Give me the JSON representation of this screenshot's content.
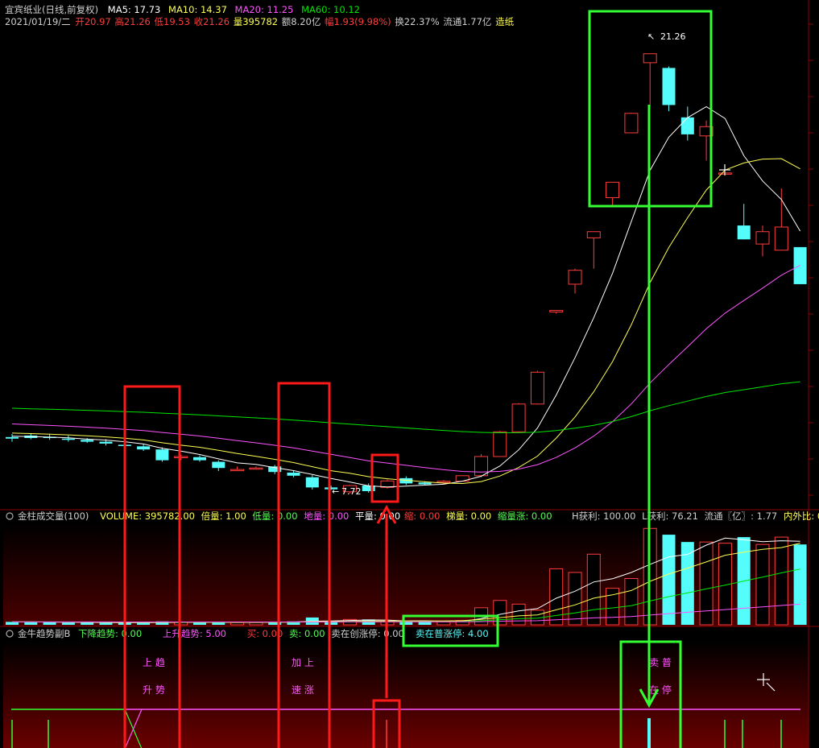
{
  "colors": {
    "up": "#ff3c3c",
    "down": "#54fcfc",
    "ma5": "#ffffff",
    "ma10": "#ffff54",
    "ma20": "#ff54ff",
    "ma60": "#00e600",
    "annot_red": "#ff1a1a",
    "annot_green": "#33ff33",
    "pane_bg": "#000000",
    "grad_top": "#000000",
    "grad_bottom": "#5a0000"
  },
  "header": {
    "stock": "宜宾纸业(日线,前复权)",
    "ma5": "MA5: 17.73",
    "ma10": "MA10: 14.37",
    "ma20": "MA20: 11.25",
    "ma60": "MA60: 10.12",
    "date": "2021/01/19/二",
    "open": "开20.97",
    "high": "高21.26",
    "low": "低19.53",
    "close": "收21.26",
    "volume": "量395782",
    "amount": "额8.20亿",
    "change": "幅1.93(9.98%)",
    "turnover": "换22.37%",
    "float": "流通1.77亿",
    "sector": "造纸"
  },
  "volume_header": {
    "name": "金柱成交量(100)",
    "volume": "VOLUME: 395782.00",
    "bei": "倍量: 1.00",
    "di": "低量: 0.00",
    "dil": "地量: 0.00",
    "ping": "平量: 0.00",
    "suo": "缩: 0.00",
    "ti": "梯量: 0.00",
    "suozhang": "缩量涨: 0.00",
    "hprofit": "H获利: 100.00",
    "lprofit": "L获利: 76.21",
    "liutong": "流通〖亿〗: 1.77",
    "neiwai": "内外比: 0"
  },
  "trend_header": {
    "name": "金牛趋势副B",
    "down": "下降趋势: 0.00",
    "up": "上升趋势: 5.00",
    "buy": "买: 0.00",
    "sell": "卖: 0.00",
    "sell_new": "卖在创涨停: 0.00",
    "sell_pu": "卖在普涨停: 4.00"
  },
  "annotations": {
    "up_trend_1": "上 趋",
    "up_trend_2": "升 势",
    "accel_1": "加 上",
    "accel_2": "速 涨",
    "sell_1": "卖 普",
    "sell_2": "在 停",
    "high_label": "21.26",
    "low_label": "7.72"
  },
  "chart_data": {
    "type": "candlestick",
    "ylim": [
      6.5,
      23.0
    ],
    "bars": [
      {
        "o": 8.85,
        "h": 8.95,
        "l": 8.7,
        "c": 8.8
      },
      {
        "o": 8.9,
        "h": 8.98,
        "l": 8.78,
        "c": 8.82
      },
      {
        "o": 8.86,
        "h": 8.96,
        "l": 8.76,
        "c": 8.82
      },
      {
        "o": 8.8,
        "h": 8.9,
        "l": 8.7,
        "c": 8.78
      },
      {
        "o": 8.76,
        "h": 8.82,
        "l": 8.66,
        "c": 8.7
      },
      {
        "o": 8.7,
        "h": 8.78,
        "l": 8.58,
        "c": 8.64
      },
      {
        "o": 8.6,
        "h": 8.7,
        "l": 8.5,
        "c": 8.56
      },
      {
        "o": 8.55,
        "h": 8.62,
        "l": 8.4,
        "c": 8.45
      },
      {
        "o": 8.45,
        "h": 8.52,
        "l": 8.05,
        "c": 8.1
      },
      {
        "o": 8.2,
        "h": 8.28,
        "l": 8.1,
        "c": 8.22
      },
      {
        "o": 8.2,
        "h": 8.26,
        "l": 8.05,
        "c": 8.1
      },
      {
        "o": 8.05,
        "h": 8.1,
        "l": 7.75,
        "c": 7.85
      },
      {
        "o": 7.8,
        "h": 7.9,
        "l": 7.75,
        "c": 7.8
      },
      {
        "o": 7.85,
        "h": 7.9,
        "l": 7.8,
        "c": 7.85
      },
      {
        "o": 7.9,
        "h": 7.95,
        "l": 7.65,
        "c": 7.72
      },
      {
        "o": 7.7,
        "h": 7.75,
        "l": 7.55,
        "c": 7.6
      },
      {
        "o": 7.55,
        "h": 7.62,
        "l": 7.15,
        "c": 7.22
      },
      {
        "o": 7.22,
        "h": 7.28,
        "l": 7.14,
        "c": 7.16
      },
      {
        "o": 7.08,
        "h": 7.3,
        "l": 7.02,
        "c": 7.28
      },
      {
        "o": 7.28,
        "h": 7.35,
        "l": 7.05,
        "c": 7.1
      },
      {
        "o": 7.22,
        "h": 7.48,
        "l": 7.18,
        "c": 7.43
      },
      {
        "o": 7.52,
        "h": 7.58,
        "l": 7.3,
        "c": 7.35
      },
      {
        "o": 7.38,
        "h": 7.42,
        "l": 7.3,
        "c": 7.32
      },
      {
        "o": 7.4,
        "h": 7.46,
        "l": 7.32,
        "c": 7.42
      },
      {
        "o": 7.42,
        "h": 7.6,
        "l": 7.42,
        "c": 7.6
      },
      {
        "o": 7.6,
        "h": 8.3,
        "l": 7.55,
        "c": 8.22
      },
      {
        "o": 8.22,
        "h": 9.05,
        "l": 8.22,
        "c": 9.02
      },
      {
        "o": 9.02,
        "h": 9.95,
        "l": 9.0,
        "c": 9.92
      },
      {
        "o": 9.92,
        "h": 11.0,
        "l": 9.9,
        "c": 10.95
      },
      {
        "o": 12.9,
        "h": 12.95,
        "l": 12.85,
        "c": 12.95
      },
      {
        "o": 13.8,
        "h": 14.3,
        "l": 13.5,
        "c": 14.25
      },
      {
        "o": 15.3,
        "h": 15.5,
        "l": 14.3,
        "c": 15.5
      },
      {
        "o": 16.6,
        "h": 17.1,
        "l": 16.35,
        "c": 17.1
      },
      {
        "o": 18.7,
        "h": 19.35,
        "l": 18.7,
        "c": 19.33
      },
      {
        "o": 20.97,
        "h": 21.26,
        "l": 19.53,
        "c": 21.26
      },
      {
        "o": 20.8,
        "h": 20.85,
        "l": 19.4,
        "c": 19.6
      },
      {
        "o": 19.2,
        "h": 19.55,
        "l": 18.45,
        "c": 18.65
      },
      {
        "o": 18.6,
        "h": 19.1,
        "l": 17.8,
        "c": 18.9
      },
      {
        "o": 17.4,
        "h": 17.4,
        "l": 17.4,
        "c": 17.4
      },
      {
        "o": 15.7,
        "h": 16.4,
        "l": 15.25,
        "c": 15.25
      },
      {
        "o": 15.1,
        "h": 15.7,
        "l": 14.7,
        "c": 15.5
      },
      {
        "o": 14.9,
        "h": 16.9,
        "l": 14.9,
        "c": 15.65
      },
      {
        "o": 15.0,
        "h": 15.0,
        "l": 13.8,
        "c": 13.8
      }
    ],
    "volume_ylim": [
      0,
      400000
    ],
    "volume": [
      12000,
      11000,
      10000,
      9000,
      9000,
      8000,
      8000,
      9000,
      14000,
      11000,
      10000,
      13000,
      9000,
      9000,
      12000,
      14000,
      30000,
      12000,
      22000,
      22000,
      12000,
      12000,
      15000,
      12000,
      18000,
      70000,
      100000,
      85000,
      60000,
      230000,
      215000,
      290000,
      150000,
      190000,
      395782,
      370000,
      340000,
      340000,
      335000,
      360000,
      330000,
      360000,
      330000
    ],
    "trend_lines": {
      "ylim": [
        0,
        10
      ],
      "up_trend": [
        0,
        0,
        0,
        0,
        0,
        0,
        0,
        0,
        0,
        0,
        0,
        0,
        0,
        0,
        0,
        0,
        0,
        0,
        0,
        0,
        0,
        0,
        0,
        0,
        0,
        0,
        0,
        0,
        0,
        0,
        0,
        0,
        0,
        0,
        0,
        0,
        0,
        0,
        0,
        0,
        0,
        0,
        0
      ]
    }
  }
}
